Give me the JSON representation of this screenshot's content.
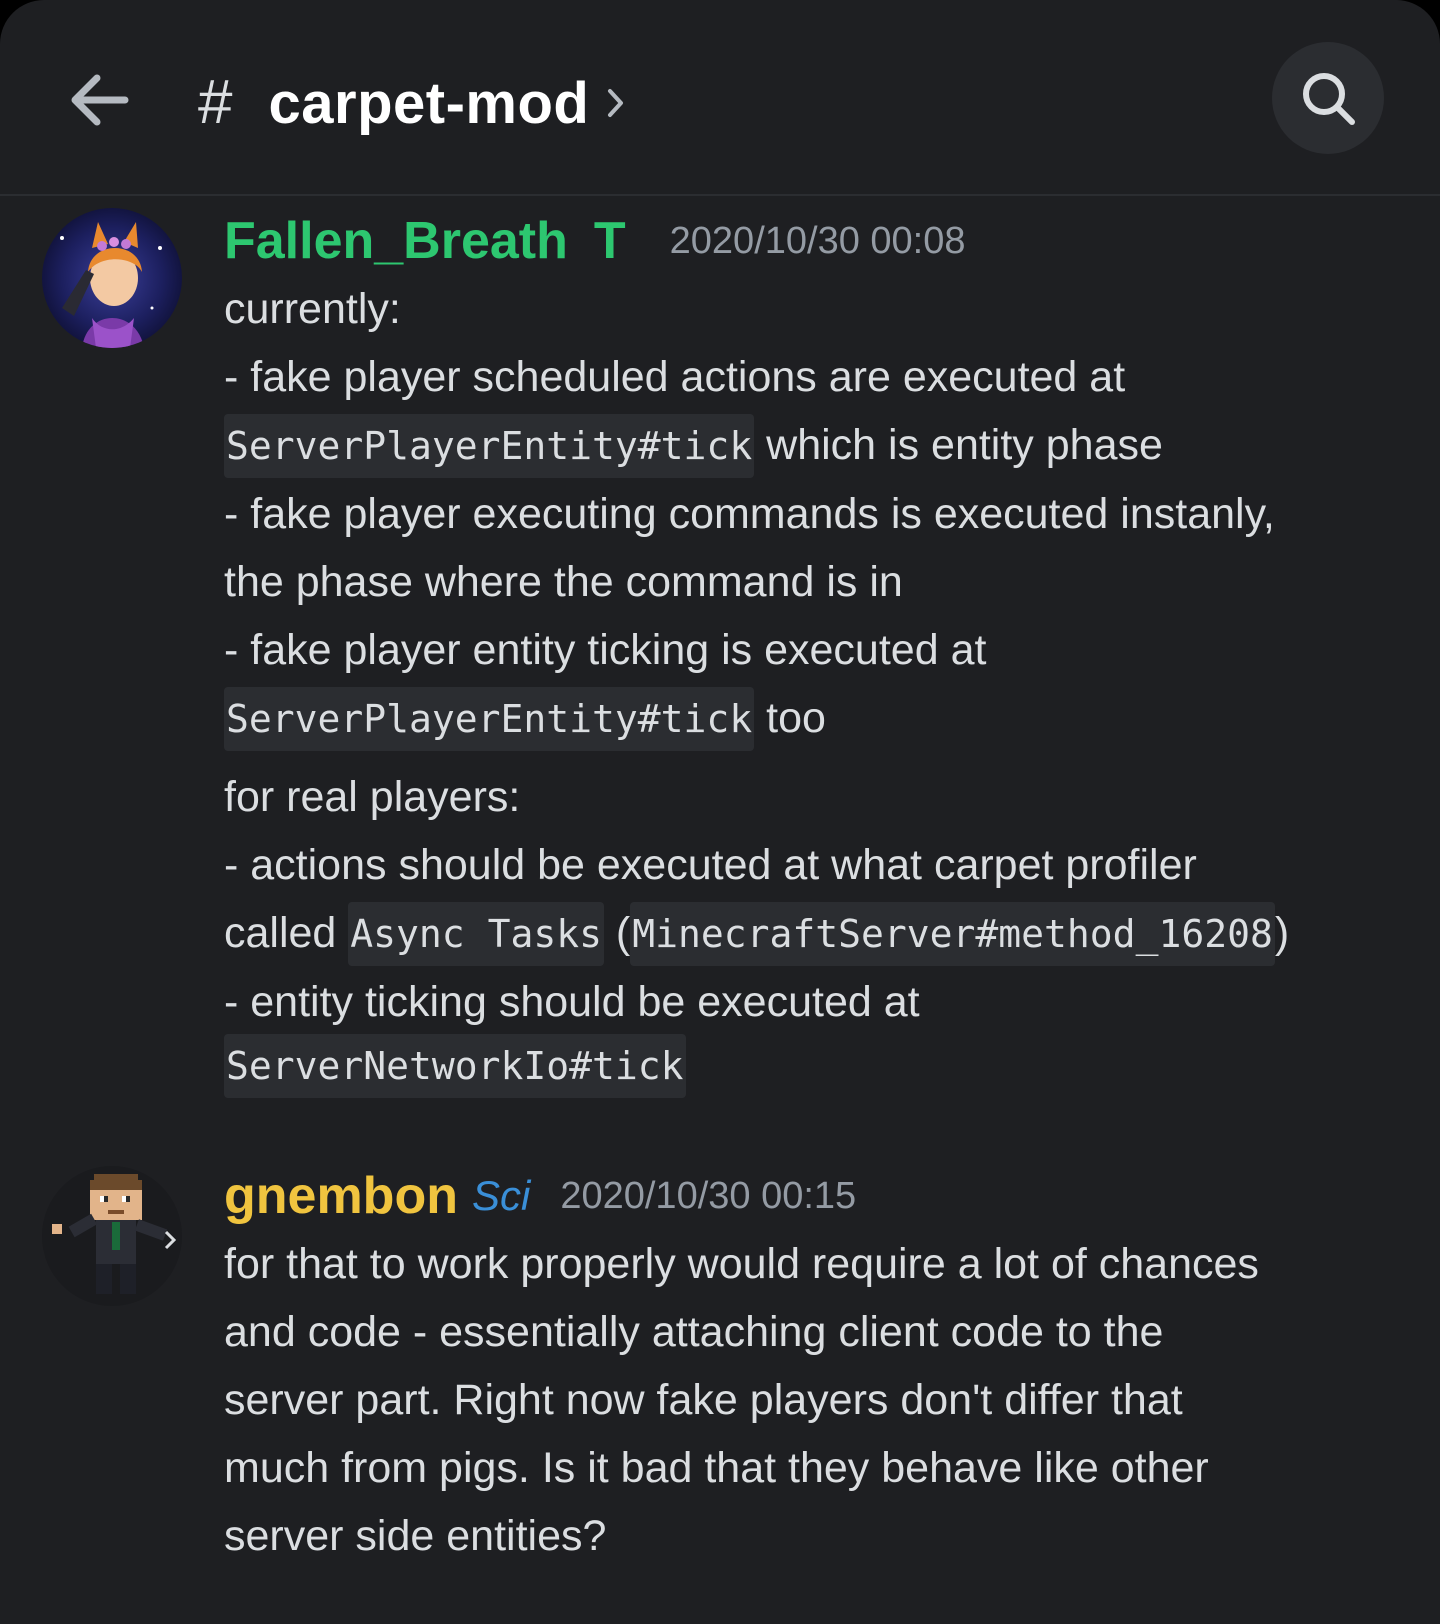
{
  "header": {
    "back_icon": "arrow-left-icon",
    "hash": "#",
    "channel_name": "carpet-mod",
    "chevron_icon": "chevron-right-icon",
    "search_icon": "search-icon"
  },
  "messages": [
    {
      "author": "Fallen_Breath",
      "author_color": "#2dc770",
      "tag": "T",
      "tag_color": "#2dc770",
      "timestamp": "2020/10/30 00:08",
      "lines": [
        {
          "text": "currently:"
        },
        {
          "text": "- fake player scheduled actions are executed at"
        },
        {
          "code": "ServerPlayerEntity#tick",
          "text": " which is entity phase"
        },
        {
          "text": "- fake player executing commands is executed instanly,"
        },
        {
          "text": "the phase where the command is in"
        },
        {
          "text": "- fake player entity ticking is executed at"
        },
        {
          "code": "ServerPlayerEntity#tick",
          "text": " too"
        },
        {
          "text": "for real players:"
        },
        {
          "text": "- actions should be executed at what carpet profiler"
        },
        {
          "pre": "called ",
          "code": "Async Tasks",
          "mid": " (",
          "code2": "MinecraftServer#method_16208",
          "post": ")"
        },
        {
          "text": "- entity ticking should be executed at"
        },
        {
          "code": "ServerNetworkIo#tick"
        }
      ]
    },
    {
      "author": "gnembon",
      "author_color": "#f0c43f",
      "tag": "Sci",
      "tag_color": "#3a8fd8",
      "timestamp": "2020/10/30 00:15",
      "lines": [
        {
          "text": "for that to work properly would require a lot of chances"
        },
        {
          "text": "and code - essentially attaching client code to the"
        },
        {
          "text": "server part. Right now fake players don't differ that"
        },
        {
          "text": "much from pigs. Is it bad that they behave like other"
        },
        {
          "text": "server side entities?"
        }
      ]
    }
  ]
}
